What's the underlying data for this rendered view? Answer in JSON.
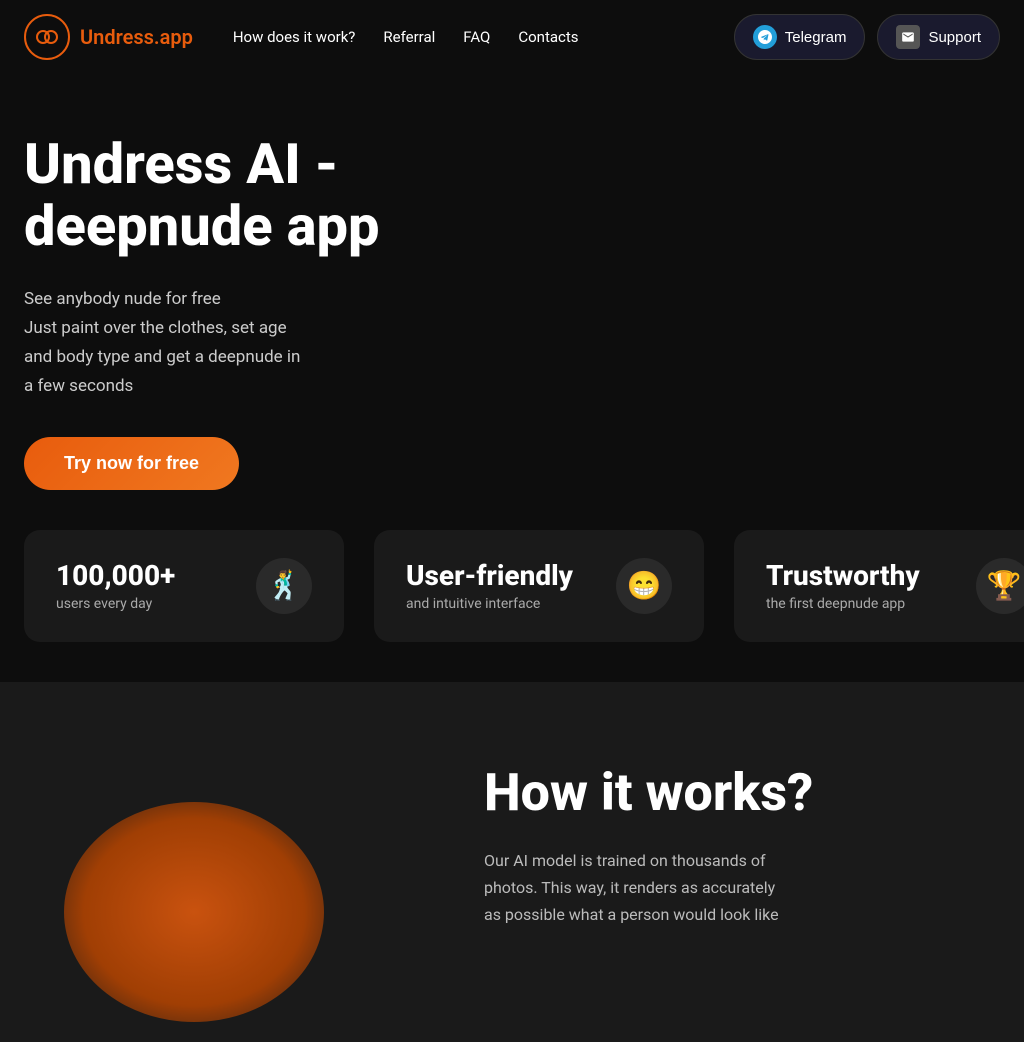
{
  "navbar": {
    "logo_icon": "🔄",
    "logo_brand": "dress.app",
    "logo_brand_highlight": "Un",
    "nav_how": "How does it work?",
    "nav_referral": "Referral",
    "nav_faq": "FAQ",
    "nav_contacts": "Contacts",
    "btn_telegram": "Telegram",
    "btn_support": "Support"
  },
  "hero": {
    "title_line1": "Undress AI -",
    "title_line2": "deepnude app",
    "description_line1": "See anybody nude for free",
    "description_line2": "Just paint over the clothes, set age",
    "description_line3": "and body type and get a deepnude in",
    "description_line4": "a few seconds",
    "cta_button": "Try now for free"
  },
  "stats": [
    {
      "number": "100,000+",
      "label": "users every day",
      "emoji": "🕺💃"
    },
    {
      "number": "User-friendly",
      "label": "and intuitive interface",
      "emoji": "😁"
    },
    {
      "number": "Trustworthy",
      "label": "the first deepnude app",
      "emoji": "🏆"
    }
  ],
  "how_it_works": {
    "title": "How it works?",
    "description_line1": "Our AI model is trained on thousands of",
    "description_line2": "photos. This way, it renders as accurately",
    "description_line3": "as possible what a person would look like"
  },
  "colors": {
    "accent": "#e85c0d",
    "background": "#0d0d0d",
    "card_bg": "#1a1a1a",
    "telegram_blue": "#229ed9"
  }
}
